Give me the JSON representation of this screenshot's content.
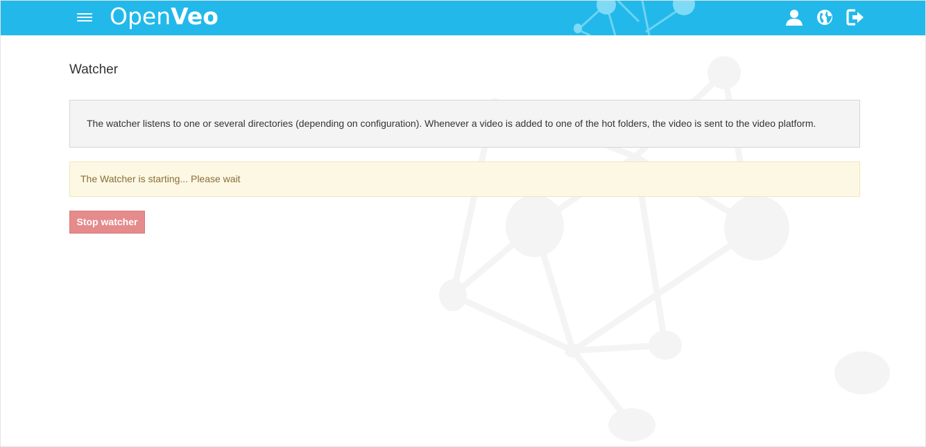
{
  "header": {
    "logo": {
      "part1": "Open",
      "part2": "Veo"
    },
    "menu_icon": "hamburger-menu-icon",
    "right_icons": [
      "user-icon",
      "globe-icon",
      "logout-icon"
    ]
  },
  "page": {
    "title": "Watcher",
    "description": "The watcher listens to one or several directories (depending on configuration). Whenever a video is added to one of the hot folders, the video is sent to the video platform.",
    "status_message": "The Watcher is starting... Please wait",
    "stop_button_label": "Stop watcher"
  },
  "colors": {
    "header_bg": "#22b9ea",
    "description_bg": "#f4f4f4",
    "warning_bg": "#fcf8e3",
    "warning_text": "#8a6d3b",
    "stop_button_bg": "#e58b8b"
  }
}
